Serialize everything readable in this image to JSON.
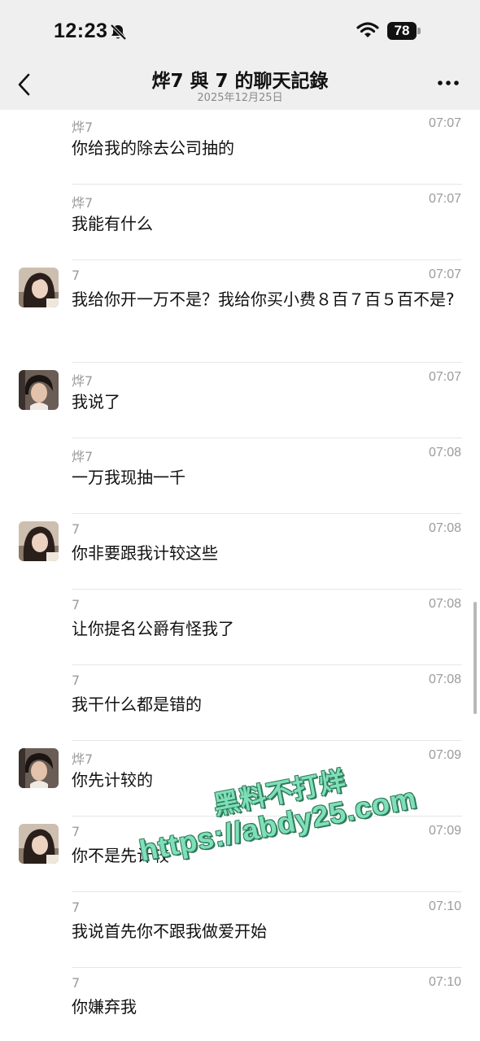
{
  "status_bar": {
    "time": "12:23",
    "battery": "78"
  },
  "header": {
    "title": "烨7 與 7 的聊天記錄",
    "date": "2025年12月25日"
  },
  "messages": [
    {
      "sender": "烨7",
      "time": "07:07",
      "text": "你给我的除去公司抽的",
      "avatar": "none"
    },
    {
      "sender": "烨7",
      "time": "07:07",
      "text": "我能有什么",
      "avatar": "none"
    },
    {
      "sender": "7",
      "time": "07:07",
      "text": "我给你开一万不是？我给你买小费８百７百５百不是?",
      "avatar": "woman"
    },
    {
      "sender": "烨7",
      "time": "07:07",
      "text": "我说了",
      "avatar": "man"
    },
    {
      "sender": "烨7",
      "time": "07:08",
      "text": "一万我现抽一千",
      "avatar": "none"
    },
    {
      "sender": "7",
      "time": "07:08",
      "text": "你非要跟我计较这些",
      "avatar": "woman"
    },
    {
      "sender": "7",
      "time": "07:08",
      "text": "让你提名公爵有怪我了",
      "avatar": "none"
    },
    {
      "sender": "7",
      "time": "07:08",
      "text": "我干什么都是错的",
      "avatar": "none"
    },
    {
      "sender": "烨7",
      "time": "07:09",
      "text": "你先计较的",
      "avatar": "man"
    },
    {
      "sender": "7",
      "time": "07:09",
      "text": "你不是先计较",
      "avatar": "woman"
    },
    {
      "sender": "7",
      "time": "07:10",
      "text": "我说首先你不跟我做爱开始",
      "avatar": "none"
    },
    {
      "sender": "7",
      "time": "07:10",
      "text": "你嫌弃我",
      "avatar": "none"
    }
  ],
  "watermark": {
    "line1": "黑料不打烊",
    "line2": "https://abdy25.com"
  },
  "icons": {
    "mute": "bell-slash-icon",
    "wifi": "wifi-icon",
    "back": "chevron-left-icon",
    "more": "ellipsis-icon"
  }
}
